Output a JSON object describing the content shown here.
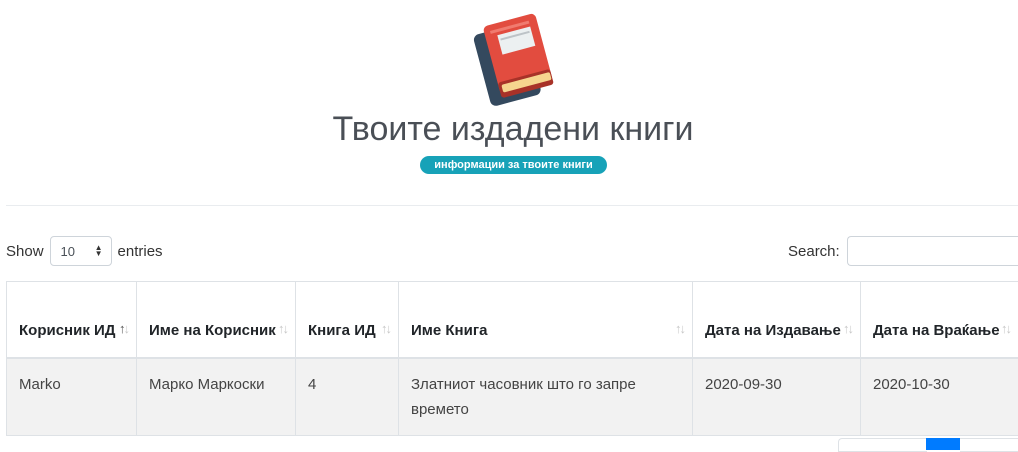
{
  "header": {
    "title": "Твоите издадени книги",
    "badge": "информации за твоите книги",
    "logo_icon": "book-icon"
  },
  "controls": {
    "show_label": "Show",
    "entries_value": "10",
    "entries_label": "entries",
    "search_label": "Search:",
    "search_value": ""
  },
  "table": {
    "columns": [
      {
        "label": "Корисник ИД",
        "sorted": "asc"
      },
      {
        "label": "Име на Корисник",
        "sorted": "none"
      },
      {
        "label": "Книга ИД",
        "sorted": "none"
      },
      {
        "label": "Име Книга",
        "sorted": "none"
      },
      {
        "label": "Дата на Издавање",
        "sorted": "none"
      },
      {
        "label": "Дата на Враќање",
        "sorted": "none"
      }
    ],
    "rows": [
      [
        "Marko",
        "Марко Маркоски",
        "4",
        "Златниот часовник што го запре времето",
        "2020-09-30",
        "2020-10-30"
      ]
    ]
  },
  "colors": {
    "badge": "#17a2b8",
    "book_red": "#e24c3f",
    "book_dark": "#34495e",
    "pagination_active": "#007bff"
  }
}
